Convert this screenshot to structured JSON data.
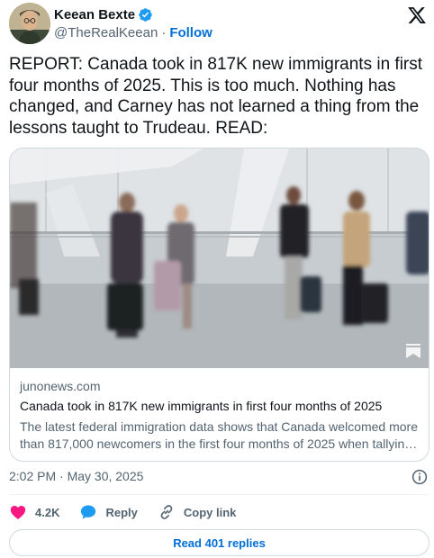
{
  "author": {
    "display_name": "Keean Bexte",
    "handle": "@TheRealKeean",
    "separator": "·",
    "follow_label": "Follow",
    "verified_color": "#1d9bf0"
  },
  "tweet": {
    "text": "REPORT: Canada took in 817K new immigrants in first four months of 2025. This is too much. Nothing has changed, and Carney has not learned a thing from the lessons taught to Trudeau. READ:"
  },
  "card": {
    "domain": "junonews.com",
    "title": "Canada took in 817K new immigrants in first four months of 2025",
    "description": "The latest federal immigration data shows that Canada welcomed more than 817,000 newcomers in the first four months of 2025 when tallyin…"
  },
  "meta": {
    "timestamp": "2:02 PM · May 30, 2025"
  },
  "actions": {
    "like_count": "4.2K",
    "reply_label": "Reply",
    "copy_link_label": "Copy link",
    "like_color": "#f91880",
    "reply_color": "#1d9bf0"
  },
  "footer": {
    "read_replies_label": "Read 401 replies"
  }
}
